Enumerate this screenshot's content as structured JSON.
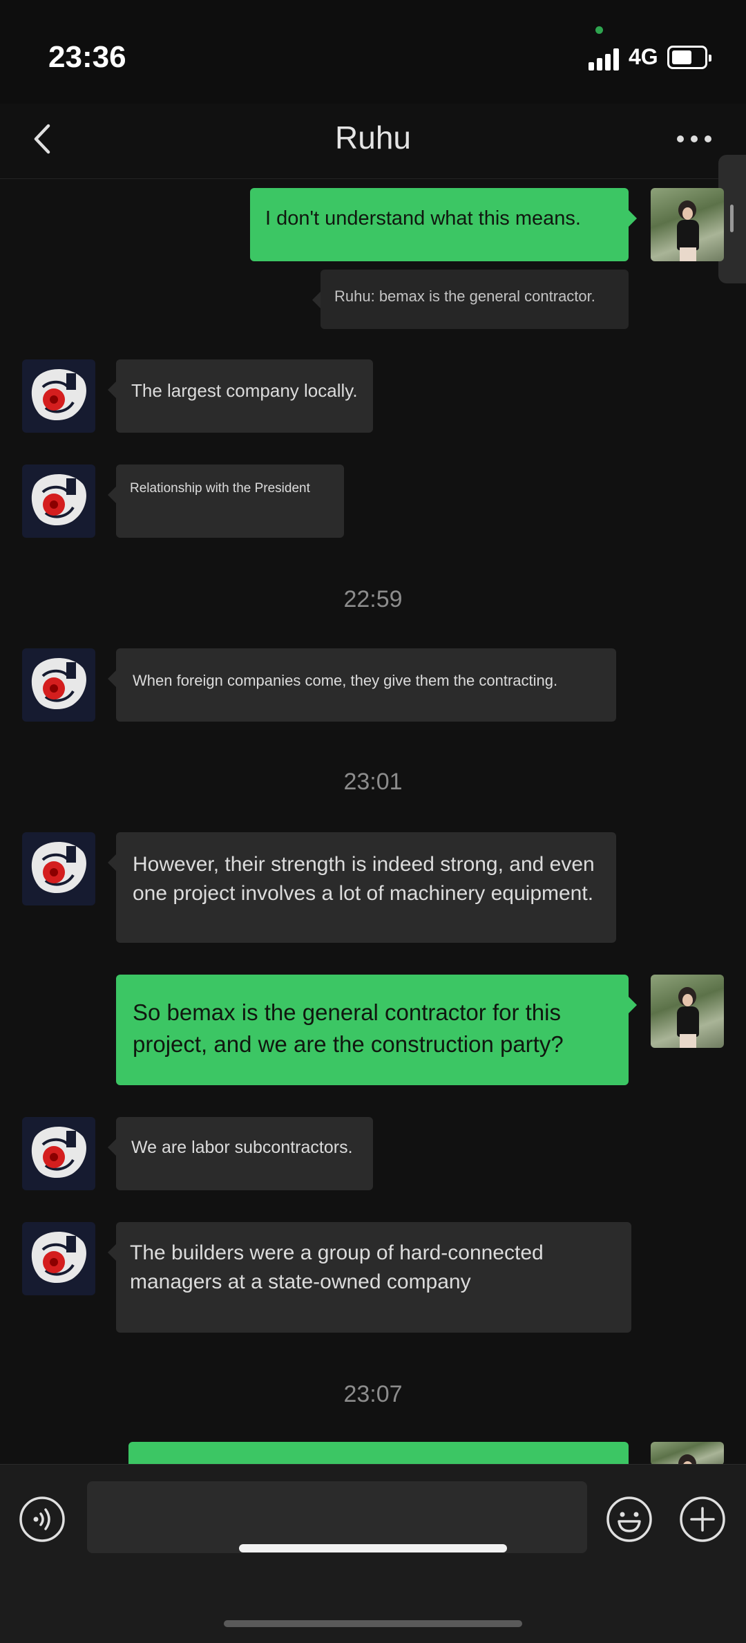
{
  "status_bar": {
    "time": "23:36",
    "network": "4G"
  },
  "header": {
    "title": "Ruhu"
  },
  "messages": [
    {
      "text": "I don't understand what this means."
    },
    {
      "text": "Ruhu: bemax is the general contractor."
    },
    {
      "text": "The largest company locally."
    },
    {
      "text": "Relationship with the President"
    },
    {
      "text": "When foreign companies come, they give them the contracting."
    },
    {
      "text": "However, their strength is indeed strong, and even one project involves a lot of machinery equipment."
    },
    {
      "text": "So bemax is the general contractor for this project, and we are the construction party?"
    },
    {
      "text": "We are labor subcontractors."
    },
    {
      "text": "The builders were a group of hard-connected managers at a state-owned company"
    },
    {
      "text": ""
    }
  ],
  "timestamps": [
    "22:59",
    "23:01",
    "23:07"
  ],
  "input": {
    "placeholder": ""
  },
  "icons": {
    "back": "chevron-left-icon",
    "more": "more-dots-icon",
    "voice": "voice-icon",
    "emoji": "emoji-icon",
    "plus": "plus-icon"
  },
  "colors": {
    "outgoing_bubble": "#3cc664",
    "incoming_bubble": "#2b2b2b",
    "background": "#111111"
  }
}
